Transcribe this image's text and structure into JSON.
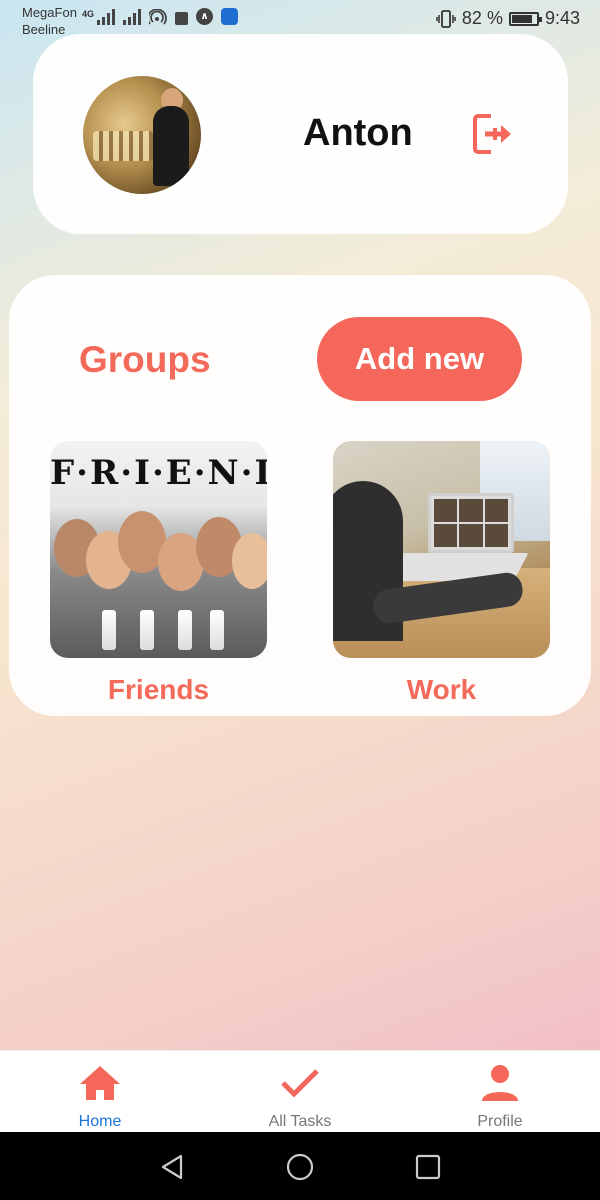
{
  "status_bar": {
    "carrier_1": "MegaFon",
    "carrier_2": "Beeline",
    "net_1": "4G",
    "battery_text": "82 %",
    "time": "9:43",
    "battery_level": 0.82
  },
  "profile": {
    "name": "Anton",
    "avatar_alt": "user avatar",
    "logout_icon": "logout-icon"
  },
  "groups": {
    "title": "Groups",
    "add_new_label": "Add new",
    "items": [
      {
        "label": "Friends",
        "image": "friends-image"
      },
      {
        "label": "Work",
        "image": "work-image"
      }
    ],
    "friends_logo_text": "F·R·I·E·N·D·S"
  },
  "bottom_nav": {
    "items": [
      {
        "label": "Home",
        "icon": "home-icon",
        "active": true
      },
      {
        "label": "All Tasks",
        "icon": "check-icon",
        "active": false
      },
      {
        "label": "Profile",
        "icon": "profile-icon",
        "active": false
      }
    ]
  },
  "colors": {
    "accent": "#f4675a",
    "active_nav": "#1a73d9"
  }
}
